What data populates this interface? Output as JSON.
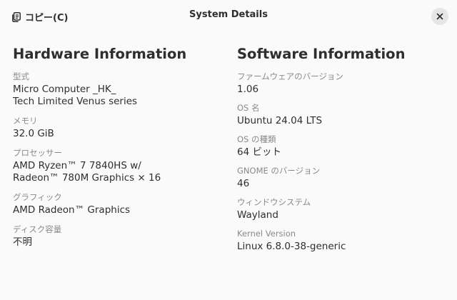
{
  "header": {
    "copy_label": "コピー(C)",
    "title": "System Details",
    "copy_icon": "copy-icon",
    "close_icon": "close-icon"
  },
  "hardware": {
    "title": "Hardware Information",
    "fields": [
      {
        "label": "型式",
        "value_lines": [
          "Micro Computer _HK_",
          "Tech Limited Venus series"
        ]
      },
      {
        "label": "メモリ",
        "value_lines": [
          "32.0 GiB"
        ]
      },
      {
        "label": "プロセッサー",
        "value_lines": [
          "AMD Ryzen™ 7 7840HS w/",
          "Radeon™ 780M Graphics × 16"
        ]
      },
      {
        "label": "グラフィック",
        "value_lines": [
          "AMD Radeon™ Graphics"
        ]
      },
      {
        "label": "ディスク容量",
        "value_lines": [
          "不明"
        ]
      }
    ]
  },
  "software": {
    "title": "Software Information",
    "fields": [
      {
        "label": "ファームウェアのバージョン",
        "value_lines": [
          "1.06"
        ]
      },
      {
        "label": "OS 名",
        "value_lines": [
          "Ubuntu 24.04 LTS"
        ]
      },
      {
        "label": "OS の種類",
        "value_lines": [
          "64 ビット"
        ]
      },
      {
        "label": "GNOME のバージョン",
        "value_lines": [
          "46"
        ]
      },
      {
        "label": "ウィンドウシステム",
        "value_lines": [
          "Wayland"
        ]
      },
      {
        "label": "Kernel Version",
        "value_lines": [
          "Linux 6.8.0-38-generic"
        ]
      }
    ]
  }
}
